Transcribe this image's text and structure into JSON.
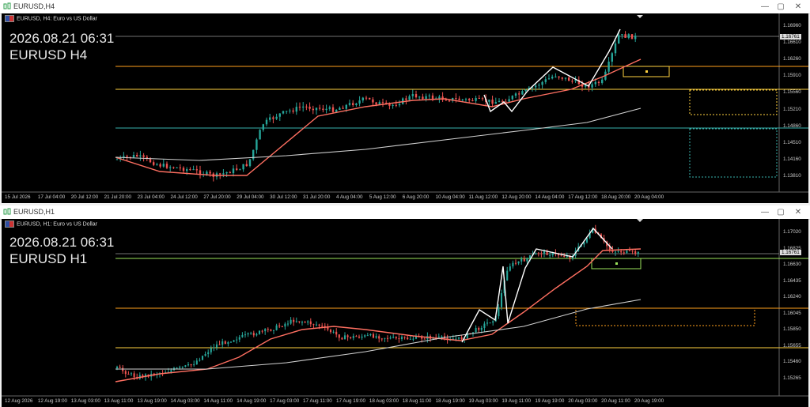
{
  "windows": [
    {
      "key": "h4",
      "window_title": "EURUSD,H4",
      "symbol_desc": "EURUSD, H4:  Euro vs US Dollar",
      "overlay_date": "2026.08.21 06:31",
      "overlay_symbol": "EURUSD H4",
      "current_price": "1.16761",
      "price_labels": [
        "1.16960",
        "1.16610",
        "1.16260",
        "1.15910",
        "1.15560",
        "1.15210",
        "1.14860",
        "1.14510",
        "1.14160",
        "1.13810"
      ],
      "time_labels": [
        "15 Jul 2026",
        "17 Jul 04:00",
        "20 Jul 12:00",
        "21 Jul 20:00",
        "23 Jul 04:00",
        "24 Jul 12:00",
        "27 Jul 20:00",
        "29 Jul 04:00",
        "30 Jul 12:00",
        "31 Jul 20:00",
        "4 Aug 04:00",
        "5 Aug 12:00",
        "6 Aug 20:00",
        "10 Aug 04:00",
        "11 Aug 12:00",
        "12 Aug 20:00",
        "14 Aug 04:00",
        "17 Aug 12:00",
        "18 Aug 20:00",
        "20 Aug 04:00"
      ]
    },
    {
      "key": "h1",
      "window_title": "EURUSD,H1",
      "symbol_desc": "EURUSD, H1:  Euro vs US Dollar",
      "overlay_date": "2026.08.21 06:31",
      "overlay_symbol": "EURUSD H1",
      "current_price": "1.16761",
      "price_labels": [
        "1.17020",
        "1.16825",
        "1.16630",
        "1.16435",
        "1.16240",
        "1.16045",
        "1.15850",
        "1.15655",
        "1.15460",
        "1.15265"
      ],
      "time_labels": [
        "12 Aug 2026",
        "12 Aug 19:00",
        "13 Aug 03:00",
        "13 Aug 11:00",
        "13 Aug 19:00",
        "14 Aug 03:00",
        "14 Aug 11:00",
        "14 Aug 19:00",
        "17 Aug 03:00",
        "17 Aug 11:00",
        "17 Aug 19:00",
        "18 Aug 03:00",
        "18 Aug 11:00",
        "18 Aug 19:00",
        "19 Aug 03:00",
        "19 Aug 11:00",
        "19 Aug 19:00",
        "20 Aug 03:00",
        "20 Aug 11:00",
        "20 Aug 19:00"
      ]
    }
  ],
  "colors": {
    "bull": "#26a69a",
    "bear": "#ef5350",
    "fast_ma": "#ff6f61",
    "slow_ma": "#d0d0d0",
    "orange": "#ff9f1c",
    "yellow": "#ffd23f",
    "teal": "#38b2ac",
    "lime": "#9be35b",
    "zigzag": "#ffffff"
  },
  "icons": {
    "app": "chart-icon",
    "minimize": "minimize-icon",
    "maximize": "maximize-icon",
    "close": "close-icon"
  }
}
